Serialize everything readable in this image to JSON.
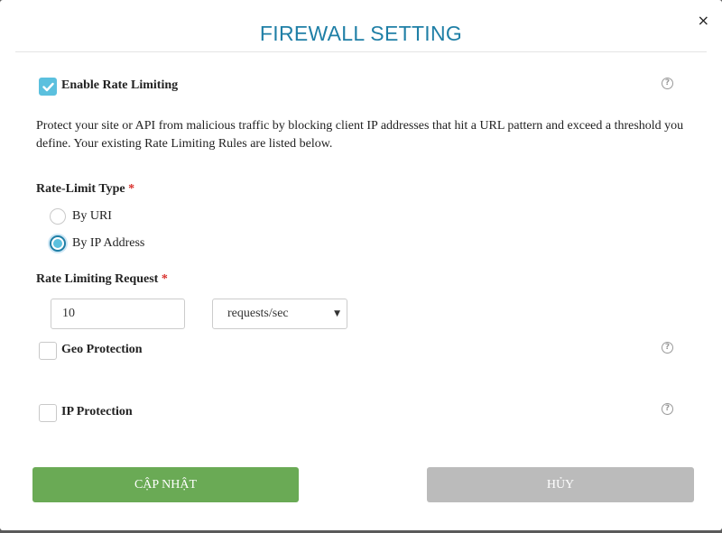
{
  "modal": {
    "title": "FIREWALL SETTING",
    "close_glyph": "×"
  },
  "rate_limiting": {
    "label": "Enable Rate Limiting",
    "checked": true,
    "help_glyph": "?",
    "description": "Protect your site or API from malicious traffic by blocking client IP addresses that hit a URL pattern and exceed a threshold you define. Your existing Rate Limiting Rules are listed below."
  },
  "rate_limit_type": {
    "label": "Rate-Limit Type",
    "required_mark": "*",
    "options": [
      {
        "label": "By URI",
        "selected": false
      },
      {
        "label": "By IP Address",
        "selected": true
      }
    ]
  },
  "rate_limiting_request": {
    "label": "Rate Limiting Request",
    "required_mark": "*",
    "value": "10",
    "unit_selected": "requests/sec",
    "caret_glyph": "▼"
  },
  "geo_protection": {
    "label": "Geo Protection",
    "checked": false,
    "help_glyph": "?"
  },
  "ip_protection": {
    "label": "IP Protection",
    "checked": false,
    "help_glyph": "?"
  },
  "buttons": {
    "update_label": "CẬP NHẬT",
    "cancel_label": "HỦY"
  },
  "colors": {
    "title": "#1f7fa6",
    "checkbox_checked": "#5bc0de",
    "required": "#d9302c",
    "update_button": "#6aaa55",
    "cancel_button": "#bbbbbb"
  }
}
